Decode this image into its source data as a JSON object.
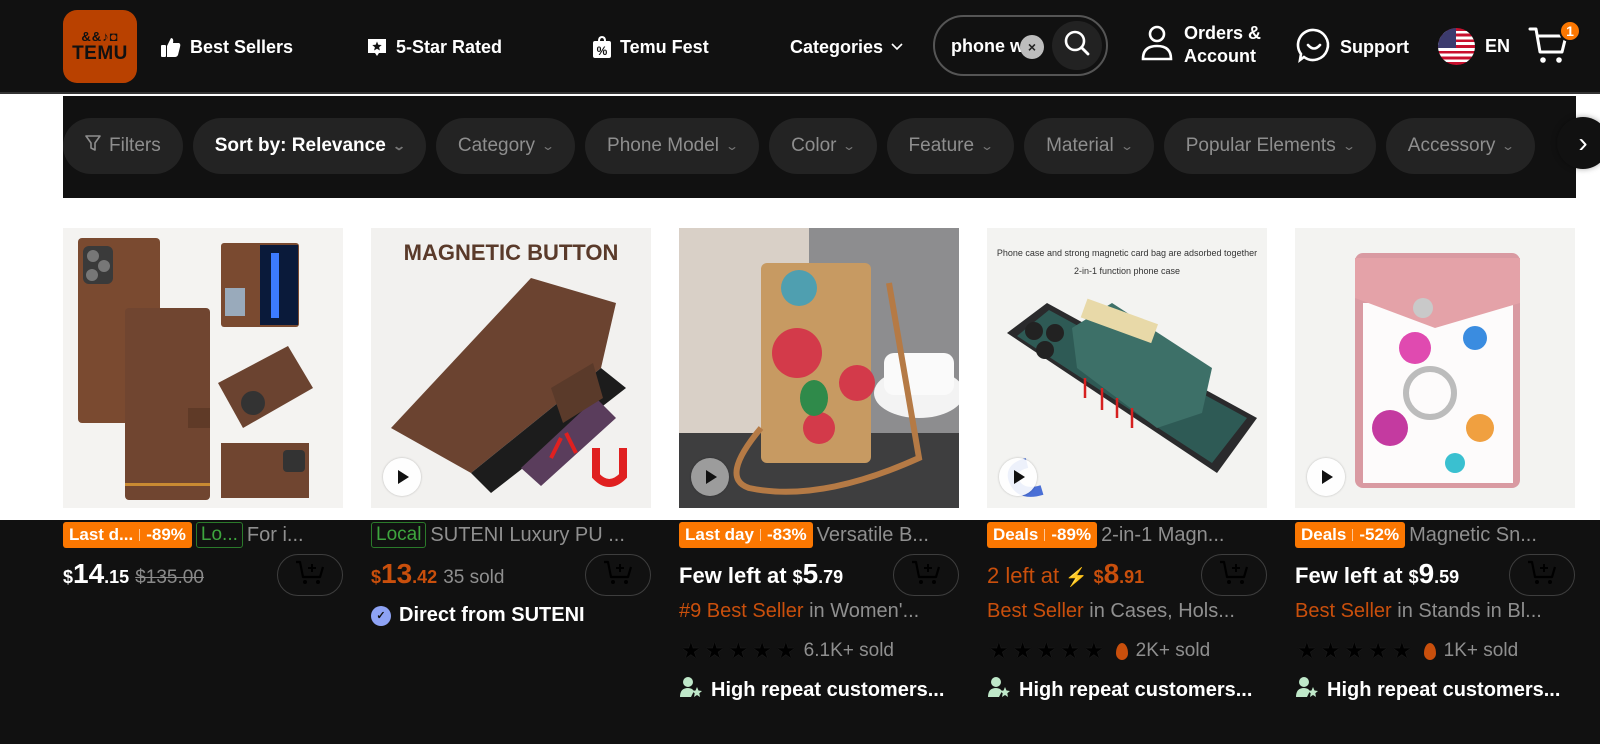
{
  "header": {
    "logo_text": "TEMU",
    "logo_glyphs": "&&♪◘",
    "nav": [
      {
        "label": "Best Sellers",
        "icon": "thumbs-up-icon"
      },
      {
        "label": "5-Star Rated",
        "icon": "star-badge-icon"
      },
      {
        "label": "Temu Fest",
        "icon": "percent-bag-icon"
      },
      {
        "label": "Categories",
        "icon": "chevron-down-icon"
      }
    ],
    "search": {
      "value": "phone wallet",
      "clear_icon": "×"
    },
    "orders_label_line1": "Orders &",
    "orders_label_line2": "Account",
    "support_label": "Support",
    "language": "EN",
    "cart_count": "1"
  },
  "filters": {
    "chips": [
      {
        "label": "Filters",
        "active": false,
        "icon": "funnel-icon"
      },
      {
        "label": "Sort by: Relevance",
        "active": true
      },
      {
        "label": "Category",
        "active": false
      },
      {
        "label": "Phone Model",
        "active": false
      },
      {
        "label": "Color",
        "active": false
      },
      {
        "label": "Feature",
        "active": false
      },
      {
        "label": "Material",
        "active": false
      },
      {
        "label": "Popular Elements",
        "active": false
      },
      {
        "label": "Accessory",
        "active": false
      }
    ],
    "chevron": "⌄",
    "next_arrow": "›"
  },
  "products": [
    {
      "deal_label": "Last d...",
      "discount": "-89%",
      "local_label": "Lo...",
      "title": "For i...",
      "price_currency": "$",
      "price_int": "14",
      "price_dec": ".15",
      "original_price": "$135.00",
      "has_video": false
    },
    {
      "local_label": "Local",
      "title": "SUTENI Luxury PU ...",
      "price_currency": "$",
      "price_int": "13",
      "price_dec": ".42",
      "sold": "35 sold",
      "seller_label": "Direct from SUTENI",
      "has_video": true,
      "image_caption": "MAGNETIC BUTTON"
    },
    {
      "deal_label": "Last day",
      "discount": "-83%",
      "title": "Versatile B...",
      "stock_prefix": "Few left at",
      "price_currency": "$",
      "price_int": "5",
      "price_dec": ".79",
      "rank": "#9 Best Seller",
      "rank_category": "in Women'...",
      "rating": 4.5,
      "sold": "6.1K+ sold",
      "repeat_label": "High repeat customers...",
      "has_video": true
    },
    {
      "deal_label": "Deals",
      "discount": "-89%",
      "title": "2-in-1 Magn...",
      "stock_prefix": "2 left at",
      "price_currency": "$",
      "price_int": "8",
      "price_dec": ".91",
      "rank": "Best Seller",
      "rank_category": "in Cases, Hols...",
      "rating": 4.5,
      "sold": "2K+ sold",
      "repeat_label": "High repeat customers...",
      "has_video": true,
      "image_caption_line1": "Phone case and strong magnetic card bag are adsorbed together",
      "image_caption_line2": "2-in-1 function phone case"
    },
    {
      "deal_label": "Deals",
      "discount": "-52%",
      "title": "Magnetic Sn...",
      "stock_prefix": "Few left at",
      "price_currency": "$",
      "price_int": "9",
      "price_dec": ".59",
      "rank": "Best Seller",
      "rank_category": "in Stands in Bl...",
      "rating": 4.5,
      "sold": "1K+ sold",
      "repeat_label": "High repeat customers...",
      "has_video": true
    }
  ],
  "colors": {
    "brand": "#fb7701",
    "logo_bg": "#b94100",
    "header_bg": "#111111",
    "price_orange": "#c94f0c",
    "local_green": "#3ea53e",
    "verified_blue": "#8ea3f5"
  }
}
